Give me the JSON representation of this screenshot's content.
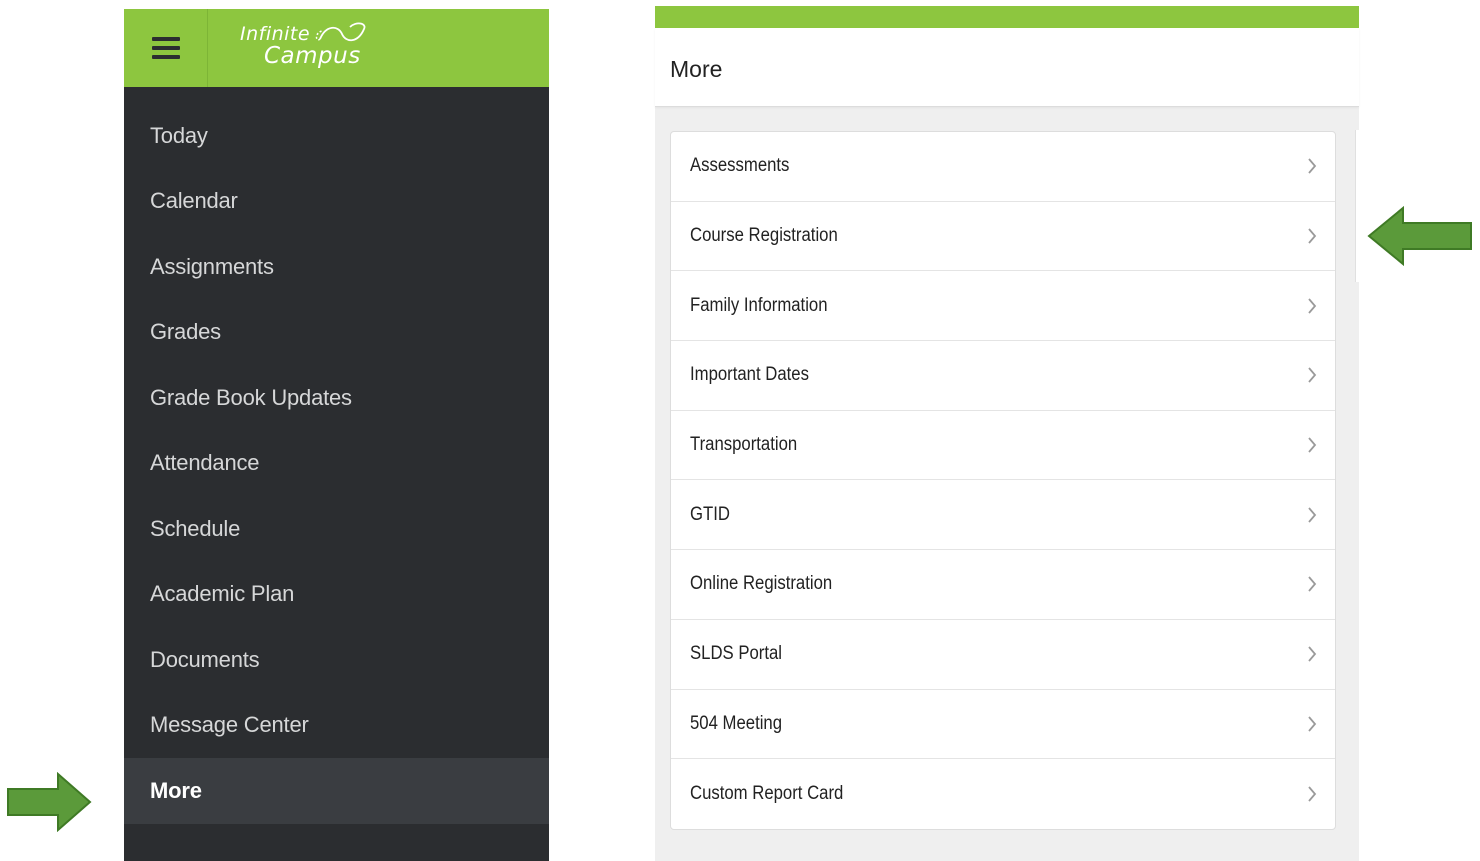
{
  "app": {
    "logo_line1": "Infinite",
    "logo_line2": "Campus",
    "brand_color": "#8dc63f",
    "nav_bg_color": "#2b2d30"
  },
  "sidebar": {
    "items": [
      {
        "label": "Today"
      },
      {
        "label": "Calendar"
      },
      {
        "label": "Assignments"
      },
      {
        "label": "Grades"
      },
      {
        "label": "Grade Book Updates"
      },
      {
        "label": "Attendance"
      },
      {
        "label": "Schedule"
      },
      {
        "label": "Academic Plan"
      },
      {
        "label": "Documents"
      },
      {
        "label": "Message Center"
      },
      {
        "label": "More",
        "active": true
      }
    ]
  },
  "main": {
    "title": "More",
    "items": [
      {
        "label": "Assessments"
      },
      {
        "label": "Course Registration"
      },
      {
        "label": "Family Information"
      },
      {
        "label": "Important Dates"
      },
      {
        "label": "Transportation"
      },
      {
        "label": "GTID"
      },
      {
        "label": "Online Registration"
      },
      {
        "label": "SLDS Portal"
      },
      {
        "label": "504 Meeting"
      },
      {
        "label": "Custom Report Card"
      }
    ]
  },
  "annotations": {
    "arrow_color": "#5b9a3a",
    "arrow1_icon": "arrow-right-icon",
    "arrow2_icon": "arrow-left-icon"
  }
}
